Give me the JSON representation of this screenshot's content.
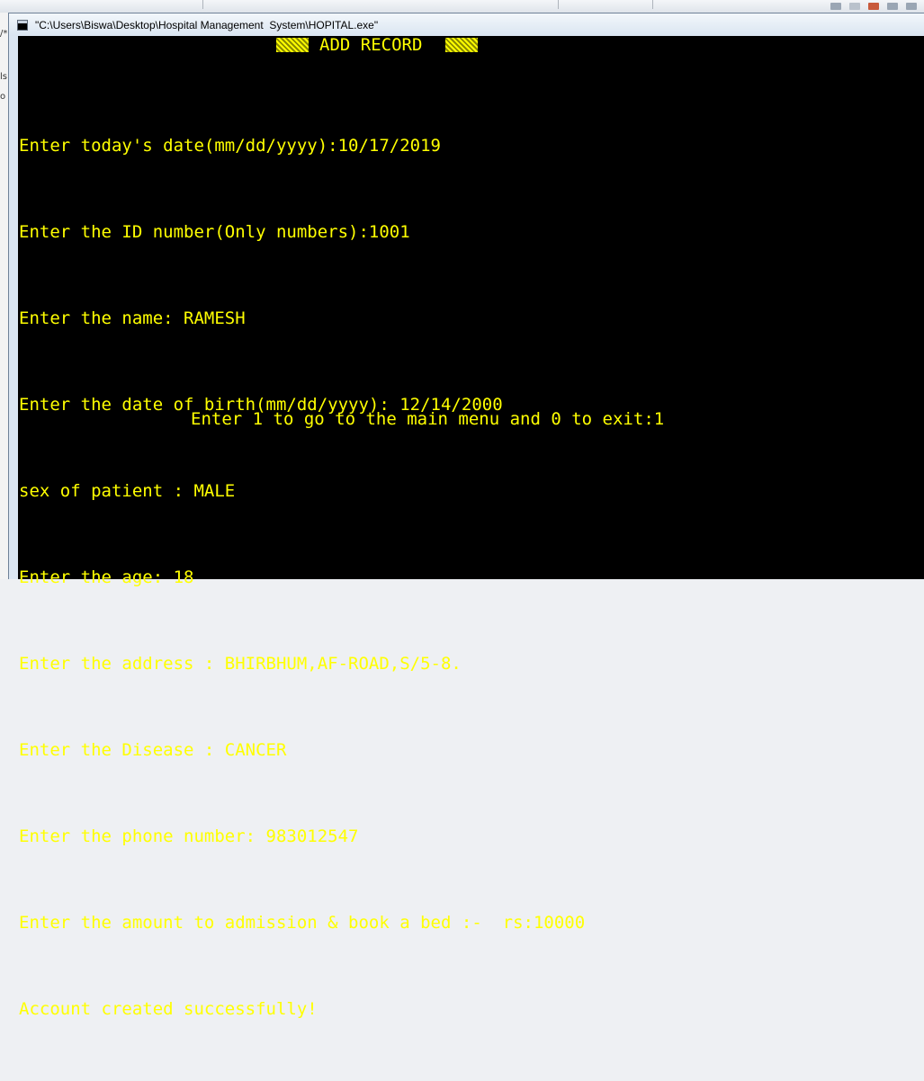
{
  "window": {
    "title": "\"C:\\Users\\Biswa\\Desktop\\Hospital Management  System\\HOPITAL.exe\""
  },
  "background": {
    "left_strip_chars": [
      "/*",
      "ls",
      "o"
    ]
  },
  "console": {
    "text_color": "#FFFF00",
    "background_color": "#000000",
    "header": "ADD RECORD",
    "lines": [
      "Enter today's date(mm/dd/yyyy):10/17/2019",
      "Enter the ID number(Only numbers):1001",
      "Enter the name: RAMESH",
      "Enter the date of birth(mm/dd/yyyy): 12/14/2000",
      "sex of patient : MALE",
      "Enter the age: 18",
      "Enter the address : BHIRBHUM,AF-ROAD,S/5-8.",
      "Enter the Disease : CANCER",
      "Enter the phone number: 983012547",
      "Enter the amount to admission & book a bed :-  rs:10000",
      "Account created successfully!"
    ],
    "menu_prompt": "Enter 1 to go to the main menu and 0 to exit:1"
  }
}
